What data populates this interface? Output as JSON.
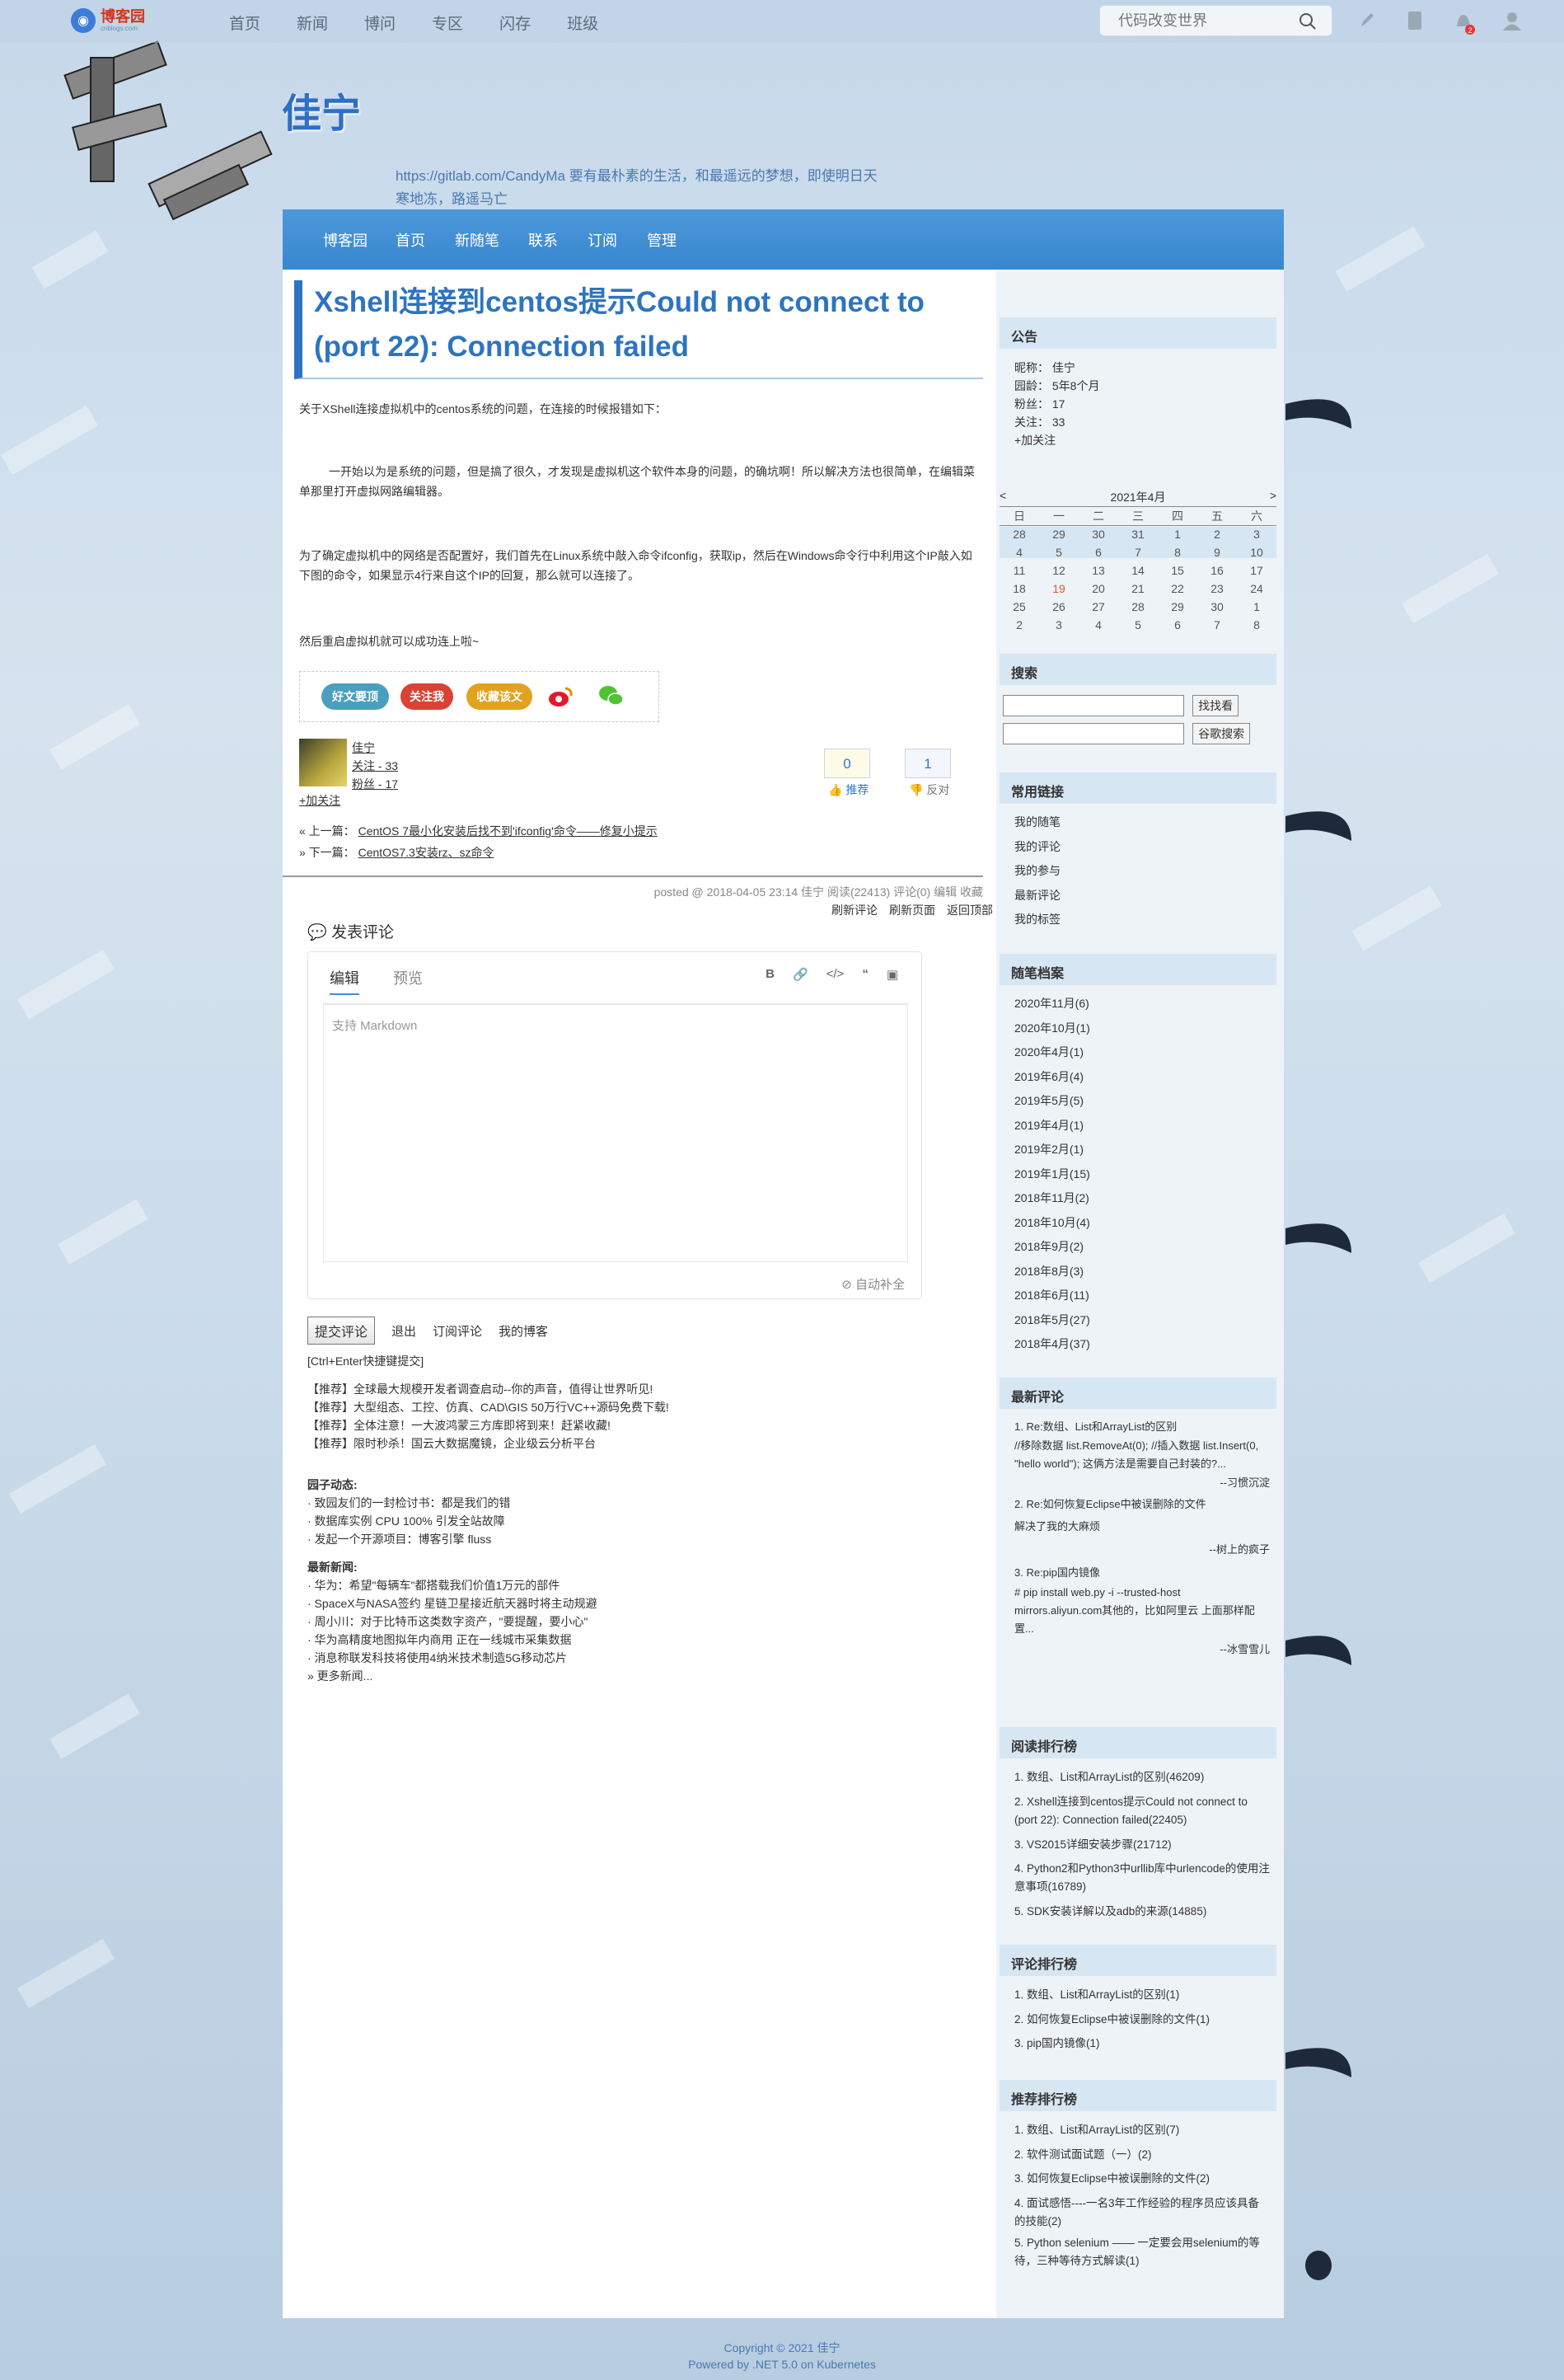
{
  "topbar": {
    "logo_text": "博客园",
    "logo_sub": "cnblogs.com",
    "nav": [
      "首页",
      "新闻",
      "博问",
      "专区",
      "闪存",
      "班级"
    ],
    "search_placeholder": "代码改变世界",
    "notif_count": "2"
  },
  "header": {
    "title": "佳宁",
    "subtitle": "https://gitlab.com/CandyMa 要有最朴素的生活，和最遥远的梦想，即使明日天寒地冻，路遥马亡"
  },
  "navbar": [
    "博客园",
    "首页",
    "新随笔",
    "联系",
    "订阅",
    "管理"
  ],
  "post": {
    "title": "Xshell连接到centos提示Could not connect to (port 22): Connection failed",
    "p1": "关于XShell连接虚拟机中的centos系统的问题，在连接的时候报错如下：",
    "p2": "一开始以为是系统的问题，但是搞了很久，才发现是虚拟机这个软件本身的问题，的确坑啊！所以解决方法也很简单，在编辑菜单那里打开虚拟网路编辑器。",
    "p3": "为了确定虚拟机中的网络是否配置好，我们首先在Linux系统中敲入命令ifconfig，获取ip，然后在Windows命令行中利用这个IP敲入如下图的命令，如果显示4行来自这个IP的回复，那么就可以连接了。",
    "p4": "然后重启虚拟机就可以成功连上啦~",
    "share": {
      "good": "好文要顶",
      "follow": "关注我",
      "fav": "收藏该文"
    },
    "author": {
      "name": "佳宁",
      "follow": "关注 - 33",
      "fans": "粉丝 - 17",
      "add": "+加关注"
    },
    "vote": {
      "up": "0",
      "up_label": "推荐",
      "down": "1",
      "down_label": "反对"
    },
    "prev_label": "« 上一篇：",
    "prev": "CentOS 7最小化安装后找不到'ifconfig'命令——修复小提示",
    "next_label": "» 下一篇：",
    "next": "CentOS7.3安装rz、sz命令",
    "postinfo": "posted @ 2018-04-05 23:14  佳宁  阅读(22413)  评论(0)  编辑  收藏",
    "links": [
      "刷新评论",
      "刷新页面",
      "返回顶部"
    ]
  },
  "comment": {
    "title": "发表评论",
    "tab_edit": "编辑",
    "tab_preview": "预览",
    "placeholder": "支持 Markdown",
    "auto": "自动补全",
    "submit": "提交评论",
    "logout": "退出",
    "subscribe": "订阅评论",
    "myblog": "我的博客",
    "hint": "[Ctrl+Enter快捷键提交]"
  },
  "ads": [
    "【推荐】全球最大规模开发者调查启动--你的声音，值得让世界听见!",
    "【推荐】大型组态、工控、仿真、CAD\\GIS 50万行VC++源码免费下载!",
    "【推荐】全体注意！一大波鸿蒙三方库即将到来！赶紧收藏!",
    "【推荐】限时秒杀！国云大数据魔镜，企业级云分析平台"
  ],
  "garden": {
    "title": "园子动态:",
    "items": [
      "· 致园友们的一封检讨书：都是我们的错",
      "· 数据库实例 CPU 100% 引发全站故障",
      "· 发起一个开源项目：博客引擎 fluss"
    ]
  },
  "news": {
    "title": "最新新闻:",
    "items": [
      "· 华为：希望\"每辆车\"都搭载我们价值1万元的部件",
      "· SpaceX与NASA签约 星链卫星接近航天器时将主动规避",
      "· 周小川：对于比特币这类数字资产，\"要提醒，要小心\"",
      "· 华为高精度地图拟年内商用 正在一线城市采集数据",
      "· 消息称联发科技将使用4纳米技术制造5G移动芯片"
    ],
    "more": "» 更多新闻..."
  },
  "sidebar": {
    "notice_title": "公告",
    "notice": [
      "昵称：   佳宁",
      "园龄：   5年8个月",
      "粉丝：   17",
      "关注：   33",
      "+加关注"
    ],
    "cal_title": "2021年4月",
    "cal_prev": "<",
    "cal_next": ">",
    "weekdays": [
      "日",
      "一",
      "二",
      "三",
      "四",
      "五",
      "六"
    ],
    "cal_rows": [
      [
        "28",
        "29",
        "30",
        "31",
        "1",
        "2",
        "3"
      ],
      [
        "4",
        "5",
        "6",
        "7",
        "8",
        "9",
        "10"
      ],
      [
        "11",
        "12",
        "13",
        "14",
        "15",
        "16",
        "17"
      ],
      [
        "18",
        "19",
        "20",
        "21",
        "22",
        "23",
        "24"
      ],
      [
        "25",
        "26",
        "27",
        "28",
        "29",
        "30",
        "1"
      ],
      [
        "2",
        "3",
        "4",
        "5",
        "6",
        "7",
        "8"
      ]
    ],
    "today_color": "#e05a2b",
    "search_title": "搜索",
    "search_btn": "找找看",
    "google_btn": "谷歌搜索",
    "links_title": "常用链接",
    "links": [
      "我的随笔",
      "我的评论",
      "我的参与",
      "最新评论",
      "我的标签"
    ],
    "archive_title": "随笔档案",
    "archive": [
      "2020年11月(6)",
      "2020年10月(1)",
      "2020年4月(1)",
      "2019年6月(4)",
      "2019年5月(5)",
      "2019年4月(1)",
      "2019年2月(1)",
      "2019年1月(15)",
      "2018年11月(2)",
      "2018年10月(4)",
      "2018年9月(2)",
      "2018年8月(3)",
      "2018年6月(11)",
      "2018年5月(27)",
      "2018年4月(37)"
    ],
    "recent_title": "最新评论",
    "recent": [
      {
        "title": "1. Re:数组、List和ArrayList的区别",
        "body": "//移除数据 list.RemoveAt(0); //插入数据 list.Insert(0, \"hello world\"); 这俩方法是需要自己封装的?...",
        "by": "--习惯沉淀"
      },
      {
        "title": "2. Re:如何恢复Eclipse中被误删除的文件",
        "body": "解决了我的大麻烦",
        "by": "--树上的疯子"
      },
      {
        "title": "3. Re:pip国内镜像",
        "body": "#    pip install web.py -i --trusted-host mirrors.aliyun.com其他的，比如阿里云 上面那样配置...",
        "by": "--冰雪雪儿"
      }
    ],
    "read_title": "阅读排行榜",
    "read": [
      "1. 数组、List和ArrayList的区别(46209)",
      "2. Xshell连接到centos提示Could not connect to (port 22): Connection failed(22405)",
      "3. VS2015详细安装步骤(21712)",
      "4. Python2和Python3中urllib库中urlencode的使用注意事项(16789)",
      "5. SDK安装详解以及adb的来源(14885)"
    ],
    "cmtrank_title": "评论排行榜",
    "cmtrank": [
      "1. 数组、List和ArrayList的区别(1)",
      "2. 如何恢复Eclipse中被误删除的文件(1)",
      "3. pip国内镜像(1)"
    ],
    "rec_title": "推荐排行榜",
    "rec": [
      "1. 数组、List和ArrayList的区别(7)",
      "2. 软件测试面试题（一）(2)",
      "3. 如何恢复Eclipse中被误删除的文件(2)",
      "4. 面试感悟----一名3年工作经验的程序员应该具备的技能(2)",
      "5. Python selenium —— 一定要会用selenium的等待，三种等待方式解读(1)"
    ]
  },
  "footer": {
    "line1": "Copyright © 2021 佳宁",
    "line2": "Powered by .NET 5.0 on Kubernetes"
  }
}
